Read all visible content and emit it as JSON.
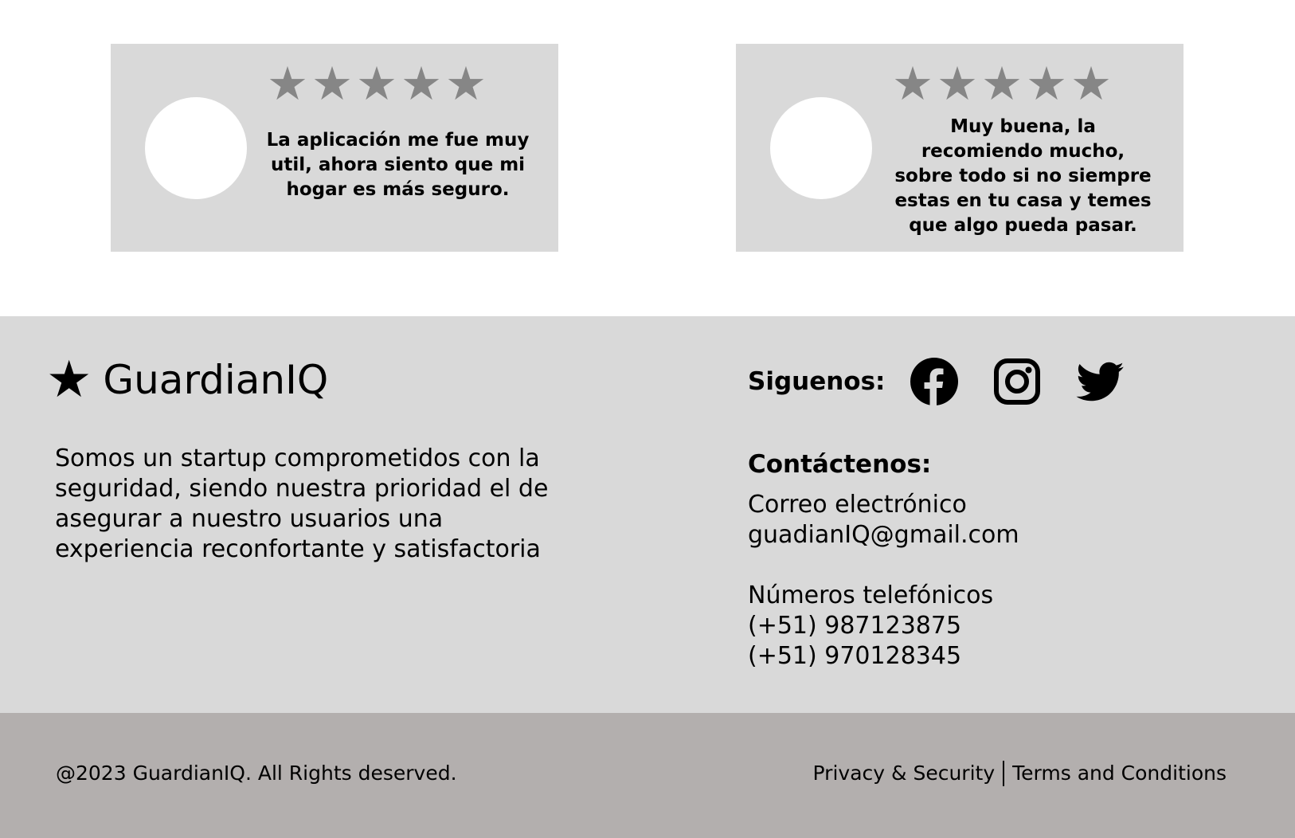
{
  "testimonials": [
    {
      "rating": 5,
      "star_glyph": "★",
      "text": "La aplicación me fue muy util, ahora siento que mi hogar es más seguro."
    },
    {
      "rating": 5,
      "star_glyph": "★",
      "text": "Muy buena, la recomiendo mucho, sobre todo si no siempre estas en tu casa y temes que algo pueda pasar."
    }
  ],
  "brand": {
    "icon": "star-icon",
    "name": "GuardianIQ"
  },
  "about": "Somos un startup comprometidos con la seguridad, siendo nuestra prioridad el de asegurar a nuestro usuarios una experiencia reconfortante y satisfactoria",
  "follow": {
    "label": "Siguenos:",
    "icons": [
      "facebook-icon",
      "instagram-icon",
      "twitter-icon"
    ]
  },
  "contact": {
    "title": "Contáctenos:",
    "email_label": "Correo electrónico",
    "email": "guadianIQ@gmail.com",
    "phones_label": "Números telefónicos",
    "phone_1": "(+51) 987123875",
    "phone_2": "(+51) 970128345"
  },
  "footer": {
    "copyright": "@2023 GuardianIQ. All Rights deserved.",
    "privacy": "Privacy & Security",
    "terms": "Terms and Conditions"
  },
  "colors": {
    "card_bg": "#d9d9d9",
    "star": "#868686",
    "info_bg": "#d9d9d9",
    "footer_bg": "#b3afae"
  }
}
